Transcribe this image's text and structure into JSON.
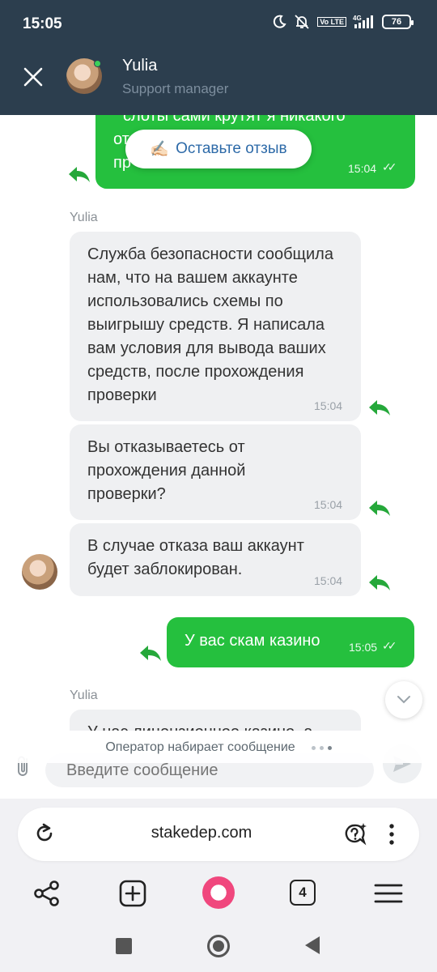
{
  "status_bar": {
    "time": "15:05",
    "network": "4G",
    "volte": "Vo LTE",
    "battery": "76"
  },
  "chat_header": {
    "agent_name": "Yulia",
    "agent_role": "Support manager"
  },
  "messages": {
    "first_out_partial": {
      "line1": "слоты сами крутят я никакого",
      "line2": "от",
      "line3": "пр",
      "time": "15:04",
      "ticks": "✓✓"
    },
    "review_button": {
      "emoji": "✍🏻",
      "label": "Оставьте отзыв"
    },
    "sender_label_1": "Yulia",
    "in_1": {
      "text": "Служба безопасности сообщила нам, что на вашем аккаунте использовались схемы по выигрышу средств. Я написала вам условия для вывода ваших средств, после прохождения проверки",
      "time": "15:04"
    },
    "in_2": {
      "text": "Вы отказываетесь от прохождения данной проверки?",
      "time": "15:04"
    },
    "in_3": {
      "text": "В случае отказа ваш аккаунт будет заблокирован.",
      "time": "15:04"
    },
    "out_2": {
      "text": "У вас скам казино",
      "time": "15:05",
      "ticks": "✓✓"
    },
    "sender_label_2": "Yulia",
    "in_4_partial": {
      "text": "У нас лицензионное казино, а"
    }
  },
  "typing": {
    "text": "Оператор набирает сообщение"
  },
  "composer": {
    "placeholder": "Введите сообщение"
  },
  "browser": {
    "url": "stakedep.com",
    "tabs_count": "4"
  },
  "colors": {
    "header_bg": "#2c3e4e",
    "outgoing_bubble": "#25c03e",
    "incoming_bubble": "#eff0f2",
    "reply_arrow": "#25a83a",
    "review_text": "#2d6aa8"
  }
}
